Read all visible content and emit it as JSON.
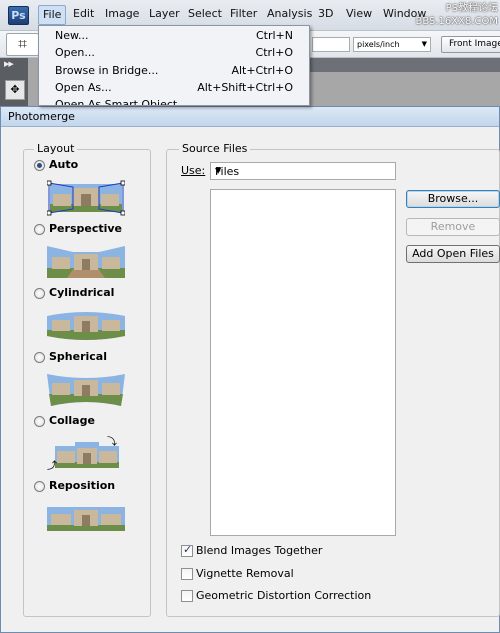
{
  "app": {
    "logo": "Ps",
    "menus": [
      "File",
      "Edit",
      "Image",
      "Layer",
      "Select",
      "Filter",
      "Analysis",
      "3D",
      "View",
      "Window"
    ],
    "active_menu": "File",
    "watermark_line1": "PS教程论坛",
    "watermark_line2": "BBS.16XX8.COM"
  },
  "options_bar": {
    "resolution_units": "pixels/inch",
    "front_image_label": "Front Image"
  },
  "file_menu": {
    "items": [
      {
        "label": "New...",
        "shortcut": "Ctrl+N"
      },
      {
        "label": "Open...",
        "shortcut": "Ctrl+O"
      },
      {
        "label": "Browse in Bridge...",
        "shortcut": "Alt+Ctrl+O"
      },
      {
        "label": "Open As...",
        "shortcut": "Alt+Shift+Ctrl+O"
      },
      {
        "label": "Open As Smart Object...",
        "shortcut": ""
      }
    ]
  },
  "dialog": {
    "title": "Photomerge",
    "layout": {
      "legend": "Layout",
      "options": [
        "Auto",
        "Perspective",
        "Cylindrical",
        "Spherical",
        "Collage",
        "Reposition"
      ],
      "selected": "Auto"
    },
    "source_files": {
      "legend": "Source Files",
      "use_label": "Use:",
      "use_value": "Files",
      "files": []
    },
    "buttons": {
      "browse": "Browse...",
      "remove": "Remove",
      "add_open_files": "Add Open Files"
    },
    "checkboxes": {
      "blend": {
        "label": "Blend Images Together",
        "checked": true
      },
      "vignette": {
        "label": "Vignette Removal",
        "checked": false
      },
      "geometric": {
        "label": "Geometric Distortion Correction",
        "checked": false
      }
    }
  },
  "colors": {
    "dialog_border": "#6e8cae",
    "titlebar": "#c2d6ec",
    "radio_dot": "#2c4f7c"
  },
  "icons": {
    "crop_tool": "crop-icon",
    "move_tool": "move-icon",
    "dropdown": "chevron-down-icon"
  }
}
